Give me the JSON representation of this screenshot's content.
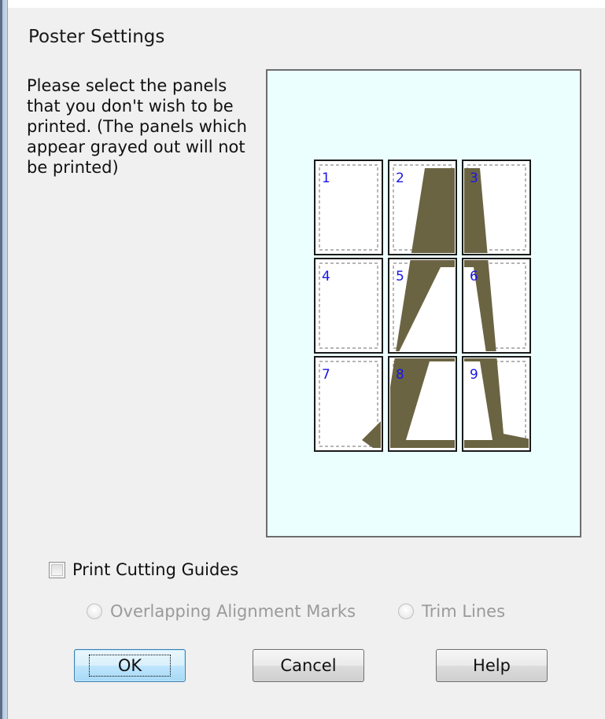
{
  "dialog": {
    "title": "Poster Settings",
    "instructions": "Please select the panels\nthat you don't wish to be\nprinted. (The panels which\nappear grayed out will not\nbe printed)"
  },
  "panels": [
    "1",
    "2",
    "3",
    "4",
    "5",
    "6",
    "7",
    "8",
    "9"
  ],
  "options": {
    "print_cutting_guides": {
      "label": "Print Cutting Guides",
      "checked": false
    },
    "overlapping_alignment_marks": {
      "label": "Overlapping Alignment Marks",
      "enabled": false
    },
    "trim_lines": {
      "label": "Trim Lines",
      "enabled": false
    }
  },
  "buttons": {
    "ok": "OK",
    "cancel": "Cancel",
    "help": "Help"
  },
  "colors": {
    "preview_background": "#ecffff",
    "panel_number": "#1a16e6",
    "artwork": "#6b6443"
  }
}
